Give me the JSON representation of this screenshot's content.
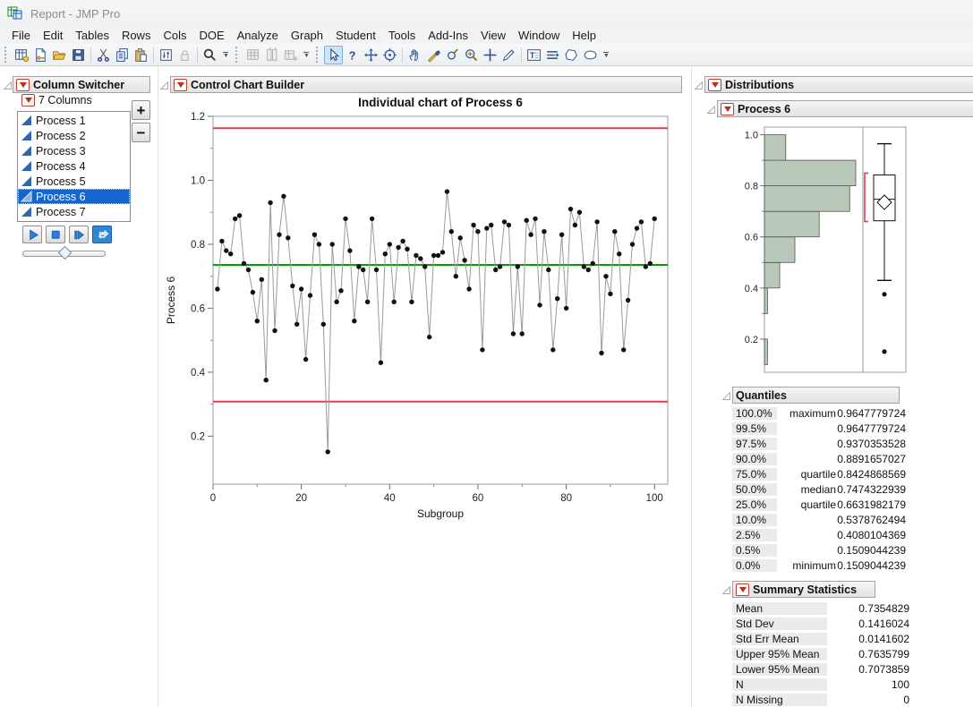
{
  "window": {
    "title": "Report - JMP Pro"
  },
  "menu_bar": {
    "items": [
      "File",
      "Edit",
      "Tables",
      "Rows",
      "Cols",
      "DOE",
      "Analyze",
      "Graph",
      "Student",
      "Tools",
      "Add-Ins",
      "View",
      "Window",
      "Help"
    ]
  },
  "toolbar": {
    "groups": [
      [
        "new-data-table",
        "new-journal",
        "open",
        "save",
        "|",
        "cut",
        "copy",
        "paste",
        "|",
        "preferences",
        "lock:disabled",
        "|",
        "search",
        "^"
      ],
      [
        "data-grid:disabled",
        "journal-cols:disabled",
        "add-table:disabled",
        "^"
      ],
      [
        "arrow:active",
        "help",
        "move",
        "target",
        "|",
        "hand",
        "brush",
        "lasso",
        "zoom-in",
        "crosshair",
        "annotate",
        "|",
        "text-box",
        "lines",
        "polygon",
        "oval",
        "^"
      ]
    ]
  },
  "column_switcher": {
    "title": "Column Switcher",
    "columns_label": "7 Columns",
    "add_label": "+",
    "remove_label": "−",
    "items": [
      "Process 1",
      "Process 2",
      "Process 3",
      "Process 4",
      "Process 5",
      "Process 6",
      "Process 7"
    ],
    "selected": "Process 6",
    "controls": [
      "play",
      "stop",
      "step",
      "loop"
    ]
  },
  "control_chart": {
    "panel_title": "Control Chart Builder"
  },
  "distributions": {
    "panel_title": "Distributions",
    "subtitle": "Process 6",
    "quantiles": {
      "title": "Quantiles",
      "rows": [
        [
          "100.0%",
          "maximum",
          "0.9647779724"
        ],
        [
          "99.5%",
          "",
          "0.9647779724"
        ],
        [
          "97.5%",
          "",
          "0.9370353528"
        ],
        [
          "90.0%",
          "",
          "0.8891657027"
        ],
        [
          "75.0%",
          "quartile",
          "0.8424868569"
        ],
        [
          "50.0%",
          "median",
          "0.7474322939"
        ],
        [
          "25.0%",
          "quartile",
          "0.6631982179"
        ],
        [
          "10.0%",
          "",
          "0.5378762494"
        ],
        [
          "2.5%",
          "",
          "0.4080104369"
        ],
        [
          "0.5%",
          "",
          "0.1509044239"
        ],
        [
          "0.0%",
          "minimum",
          "0.1509044239"
        ]
      ]
    },
    "summary": {
      "title": "Summary Statistics",
      "rows": [
        [
          "Mean",
          "0.7354829"
        ],
        [
          "Std Dev",
          "0.1416024"
        ],
        [
          "Std Err Mean",
          "0.0141602"
        ],
        [
          "Upper 95% Mean",
          "0.7635799"
        ],
        [
          "Lower 95% Mean",
          "0.7073859"
        ],
        [
          "N",
          "100"
        ],
        [
          "N Missing",
          "0"
        ]
      ]
    }
  },
  "colors": {
    "limit_line": "#e23b50",
    "center_line": "#00a000",
    "series_line": "#9a9a9a",
    "point": "#111111",
    "histogram_fill": "#b9c8b9",
    "histogram_stroke": "#4e564e",
    "selection_blue": "#1565cf"
  },
  "chart_data": [
    {
      "id": "control-chart",
      "type": "line",
      "title": "Individual chart of Process 6",
      "xlabel": "Subgroup",
      "ylabel": "Process 6",
      "xlim": [
        0,
        103
      ],
      "ylim": [
        0.05,
        1.2
      ],
      "xticks": [
        0,
        20,
        40,
        60,
        80,
        100
      ],
      "xticks_minor": [
        10,
        30,
        50,
        70,
        90
      ],
      "yticks": [
        0.2,
        0.4,
        0.6,
        0.8,
        1.0,
        1.2
      ],
      "yticks_minor": [
        0.3,
        0.5,
        0.7,
        0.9,
        1.1
      ],
      "ucl": 1.163,
      "center": 0.7355,
      "lcl": 0.308,
      "values": [
        0.66,
        0.81,
        0.78,
        0.77,
        0.88,
        0.89,
        0.74,
        0.72,
        0.65,
        0.56,
        0.69,
        0.3755,
        0.93,
        0.53,
        0.83,
        0.95,
        0.82,
        0.67,
        0.55,
        0.66,
        0.44,
        0.64,
        0.83,
        0.8,
        0.55,
        0.1509,
        0.8,
        0.62,
        0.655,
        0.88,
        0.78,
        0.56,
        0.73,
        0.72,
        0.62,
        0.88,
        0.72,
        0.43,
        0.77,
        0.8,
        0.62,
        0.79,
        0.81,
        0.785,
        0.62,
        0.765,
        0.755,
        0.73,
        0.51,
        0.765,
        0.765,
        0.775,
        0.9648,
        0.84,
        0.7,
        0.82,
        0.75,
        0.66,
        0.86,
        0.84,
        0.47,
        0.85,
        0.86,
        0.72,
        0.73,
        0.87,
        0.86,
        0.52,
        0.73,
        0.52,
        0.875,
        0.83,
        0.88,
        0.61,
        0.84,
        0.72,
        0.47,
        0.63,
        0.83,
        0.6,
        0.91,
        0.86,
        0.9,
        0.73,
        0.72,
        0.74,
        0.87,
        0.46,
        0.7,
        0.645,
        0.84,
        0.77,
        0.47,
        0.625,
        0.8,
        0.85,
        0.87,
        0.73,
        0.74,
        0.88
      ]
    },
    {
      "id": "distribution-histogram",
      "type": "histogram",
      "orientation": "horizontal",
      "ylim": [
        0.07,
        1.03
      ],
      "axis_ticks": [
        0.2,
        0.4,
        0.6,
        0.8,
        1.0
      ],
      "axis_ticks_minor": [
        0.3,
        0.5,
        0.7,
        0.9
      ],
      "bins": [
        {
          "from": 0.1,
          "to": 0.2,
          "count": 1
        },
        {
          "from": 0.2,
          "to": 0.3,
          "count": 0
        },
        {
          "from": 0.3,
          "to": 0.4,
          "count": 1
        },
        {
          "from": 0.4,
          "to": 0.5,
          "count": 5
        },
        {
          "from": 0.5,
          "to": 0.6,
          "count": 10
        },
        {
          "from": 0.6,
          "to": 0.7,
          "count": 18
        },
        {
          "from": 0.7,
          "to": 0.8,
          "count": 28
        },
        {
          "from": 0.8,
          "to": 0.9,
          "count": 30
        },
        {
          "from": 0.9,
          "to": 1.0,
          "count": 7
        }
      ]
    },
    {
      "id": "distribution-boxplot",
      "type": "boxplot",
      "whisker_low": 0.43,
      "q1": 0.6631982179,
      "median": 0.7474322939,
      "q3": 0.8424868569,
      "whisker_high": 0.9647779724,
      "mean": 0.7354829,
      "mean_ci": [
        0.7073859,
        0.7635799
      ],
      "shortest_half": [
        0.66,
        0.85
      ],
      "outliers": [
        0.3755,
        0.1509
      ]
    }
  ]
}
